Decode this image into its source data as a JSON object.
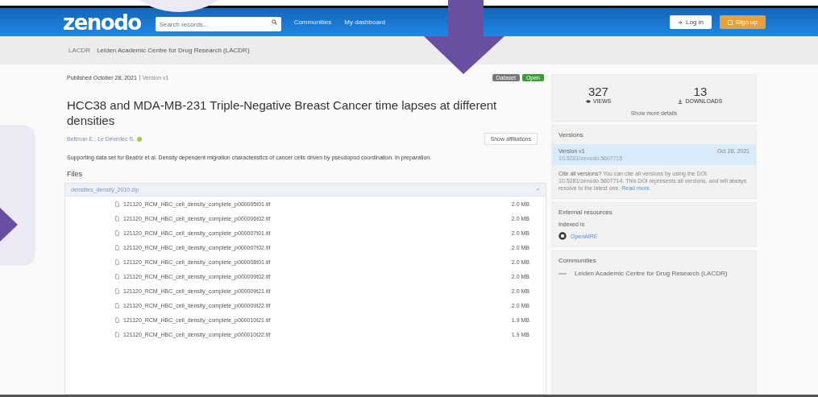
{
  "navbar": {
    "logo": "zenodo",
    "search": {
      "placeholder": "Search records..."
    },
    "links": [
      "Communities",
      "My dashboard"
    ],
    "buttons": [
      {
        "label": "Log in",
        "kind": "login"
      },
      {
        "label": "Sign up",
        "kind": "signup"
      }
    ]
  },
  "breadcrumb": {
    "code": "LACDR",
    "name": "Leiden Academic Centre for Drug Research (LACDR)"
  },
  "record": {
    "published": "Published October 28, 2021",
    "version": "Version v1",
    "badges": [
      {
        "label": "Dataset",
        "color": "#777777"
      },
      {
        "label": "Open",
        "color": "#3c9a3c"
      }
    ],
    "title": "HCC38 and MDA-MB-231 Triple-Negative Breast Cancer time lapses at different densities",
    "authors": "Beltman E.; Le Dévédec S.",
    "affiliations_button": "Show affiliations",
    "description": "Supporting data set for Beatriz et al. Density dependent migration characteristics of cancer cells driven by pseudopod coordination. In preparation.",
    "files_heading": "Files",
    "archive": "densities_density_2010.zip",
    "files": [
      {
        "name": "121120_RCM_HBC_cell_density_complete_p000005t01.tif",
        "size": "2.0 MB"
      },
      {
        "name": "121120_RCM_HBC_cell_density_complete_p000006t02.tif",
        "size": "2.0 MB"
      },
      {
        "name": "121120_RCM_HBC_cell_density_complete_p000007t01.tif",
        "size": "2.0 MB"
      },
      {
        "name": "121120_RCM_HBC_cell_density_complete_p000007t02.tif",
        "size": "2.0 MB"
      },
      {
        "name": "121120_RCM_HBC_cell_density_complete_p000008t01.tif",
        "size": "2.0 MB"
      },
      {
        "name": "121120_RCM_HBC_cell_density_complete_p000009t02.tif",
        "size": "2.0 MB"
      },
      {
        "name": "121120_RCM_HBC_cell_density_complete_p000009t21.tif",
        "size": "2.0 MB"
      },
      {
        "name": "121120_RCM_HBC_cell_density_complete_p000009t22.tif",
        "size": "2.0 MB"
      },
      {
        "name": "121120_RCM_HBC_cell_density_complete_p000010t21.tif",
        "size": "1.9 MB"
      },
      {
        "name": "121120_RCM_HBC_cell_density_complete_p000010t22.tif",
        "size": "1.9 MB"
      }
    ]
  },
  "stats": {
    "views": "327",
    "views_label": "VIEWS",
    "downloads": "13",
    "downloads_label": "DOWNLOADS",
    "more": "Show more details"
  },
  "versions": {
    "heading": "Versions",
    "items": [
      {
        "label": "Version v1",
        "date": "Oct 28, 2021",
        "doi": "10.5281/zenodo.5607715",
        "selected": true
      }
    ],
    "cite_text": "**Cite all versions?** You can cite all versions by using the DOI 10.5281/zenodo.5607714. This DOI represents all versions, and will always resolve to the latest one.",
    "read_more": "Read more."
  },
  "external": {
    "heading": "External resources",
    "indexed": "Indexed in",
    "link": "OpenAIRE"
  },
  "communities": {
    "heading": "Communities",
    "items": [
      "Leiden Academic Centre for Drug Research (LACDR)"
    ]
  }
}
